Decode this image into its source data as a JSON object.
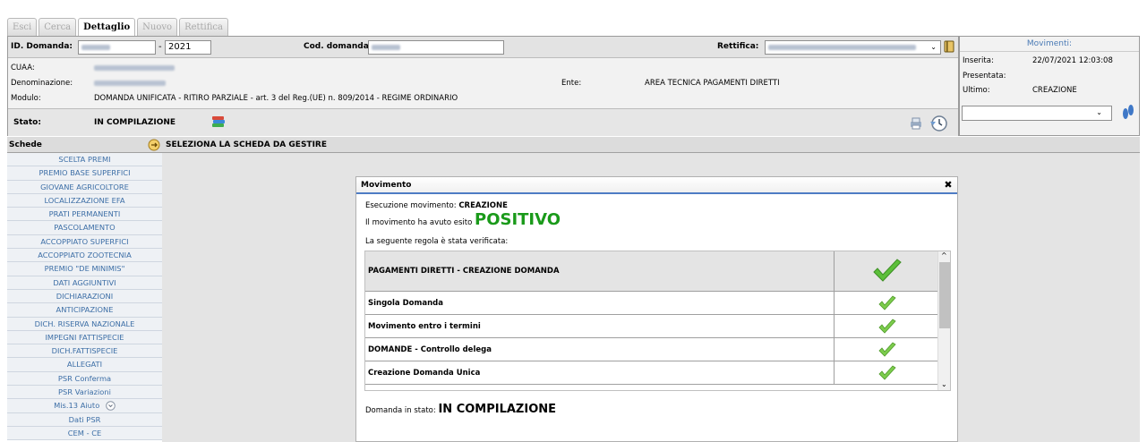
{
  "tabs": [
    {
      "label": "Esci",
      "active": false
    },
    {
      "label": "Cerca",
      "active": false
    },
    {
      "label": "Dettaglio",
      "active": true
    },
    {
      "label": "Nuovo",
      "active": false
    },
    {
      "label": "Rettifica",
      "active": false
    }
  ],
  "header": {
    "id_domanda_label": "ID. Domanda:",
    "year_value": "2021",
    "cod_domanda_label": "Cod. domanda:",
    "rettifica_label": "Rettifica:",
    "cuaa_label": "CUAA:",
    "denominazione_label": "Denominazione:",
    "modulo_label": "Modulo:",
    "modulo_value": "DOMANDA UNIFICATA - RITIRO PARZIALE - art. 3 del Reg.(UE) n. 809/2014 - REGIME ORDINARIO",
    "ente_label": "Ente:",
    "ente_value": "AREA TECNICA PAGAMENTI DIRETTI",
    "stato_label": "Stato:",
    "stato_value": "IN COMPILAZIONE"
  },
  "movimenti": {
    "title": "Movimenti:",
    "inserita_label": "Inserita:",
    "inserita_value": "22/07/2021 12:03:08",
    "presentata_label": "Presentata:",
    "presentata_value": "",
    "ultimo_label": "Ultimo:",
    "ultimo_value": "CREAZIONE"
  },
  "sidebar": {
    "title": "Schede",
    "items": [
      "SCELTA PREMI",
      "PREMIO BASE SUPERFICI",
      "GIOVANE AGRICOLTORE",
      "LOCALIZZAZIONE EFA",
      "PRATI PERMANENTI",
      "PASCOLAMENTO",
      "ACCOPPIATO SUPERFICI",
      "ACCOPPIATO ZOOTECNIA",
      "PREMIO \"DE MINIMIS\"",
      "DATI AGGIUNTIVI",
      "DICHIARAZIONI",
      "ANTICIPAZIONE",
      "DICH. RISERVA NAZIONALE",
      "IMPEGNI FATTISPECIE",
      "DICH.FATTISPECIE",
      "ALLEGATI",
      "PSR Conferma",
      "PSR Variazioni",
      "Mis.13 Aiuto",
      "Dati PSR",
      "CEM - CE"
    ]
  },
  "main_header": "SELEZIONA LA SCHEDA DA GESTIRE",
  "modal": {
    "title": "Movimento",
    "esecuzione_prefix": "Esecuzione movimento: ",
    "esecuzione_value": "CREAZIONE",
    "esito_prefix": "Il movimento ha avuto esito ",
    "esito_value": "POSITIVO",
    "regola_text": "La seguente regola è stata verificata:",
    "rules": [
      "PAGAMENTI DIRETTI - CREAZIONE DOMANDA",
      "Singola Domanda",
      "Movimento entro i termini",
      "DOMANDE - Controllo delega",
      "Creazione Domanda Unica"
    ],
    "stato_prefix": "Domanda in stato: ",
    "stato_value": "IN COMPILAZIONE"
  },
  "colors": {
    "accent_blue": "#3c6ea6",
    "positive_green": "#1a9a1a"
  }
}
